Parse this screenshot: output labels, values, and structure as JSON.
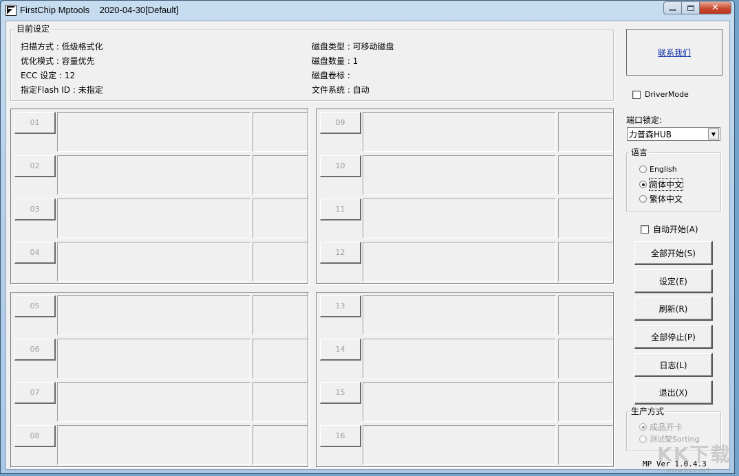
{
  "window": {
    "title": "FirstChip Mptools    2020-04-30[Default]",
    "controls": {
      "minimize": "minimize",
      "maximize": "maximize",
      "close": "✕"
    }
  },
  "settings": {
    "legend": "目前设定",
    "left": [
      "扫描方式 : 低级格式化",
      "优化模式 : 容量优先",
      "ECC 设定 : 12",
      "指定Flash ID : 未指定"
    ],
    "right": [
      "磁盘类型 : 可移动磁盘",
      "磁盘数量 : 1",
      "磁盘卷标 :",
      "文件系统 : 自动"
    ]
  },
  "ports": [
    {
      "panel": "top-left",
      "ids": [
        "01",
        "02",
        "03",
        "04"
      ]
    },
    {
      "panel": "top-right",
      "ids": [
        "09",
        "10",
        "11",
        "12"
      ]
    },
    {
      "panel": "bottom-left",
      "ids": [
        "05",
        "06",
        "07",
        "08"
      ]
    },
    {
      "panel": "bottom-right",
      "ids": [
        "13",
        "14",
        "15",
        "16"
      ]
    }
  ],
  "sidebar": {
    "contact_link": "联系我们",
    "driver_mode": {
      "label": "DriverMode",
      "checked": false
    },
    "port_lock": {
      "label": "端口锁定:",
      "selected": "力普森HUB"
    },
    "language": {
      "legend": "语言",
      "options": [
        {
          "label": "English",
          "selected": false
        },
        {
          "label": "简体中文",
          "selected": true
        },
        {
          "label": "繁体中文",
          "selected": false
        }
      ]
    },
    "auto_start": {
      "label": "自动开始(A)",
      "checked": false
    },
    "buttons": [
      {
        "name": "start-all-button",
        "label": "全部开始(S)"
      },
      {
        "name": "settings-button",
        "label": "设定(E)"
      },
      {
        "name": "refresh-button",
        "label": "刷新(R)"
      },
      {
        "name": "stop-all-button",
        "label": "全部停止(P)"
      },
      {
        "name": "log-button",
        "label": "日志(L)"
      },
      {
        "name": "exit-button",
        "label": "退出(X)"
      }
    ],
    "production": {
      "legend": "生产方式",
      "options": [
        {
          "label": "成品开卡",
          "selected": true,
          "disabled": true
        },
        {
          "label": "测试架Sorting",
          "selected": false,
          "disabled": true
        }
      ]
    },
    "version": "MP Ver 1.0.4.3"
  },
  "watermark": {
    "text": "KK下载",
    "url": "www.kkx.net"
  }
}
